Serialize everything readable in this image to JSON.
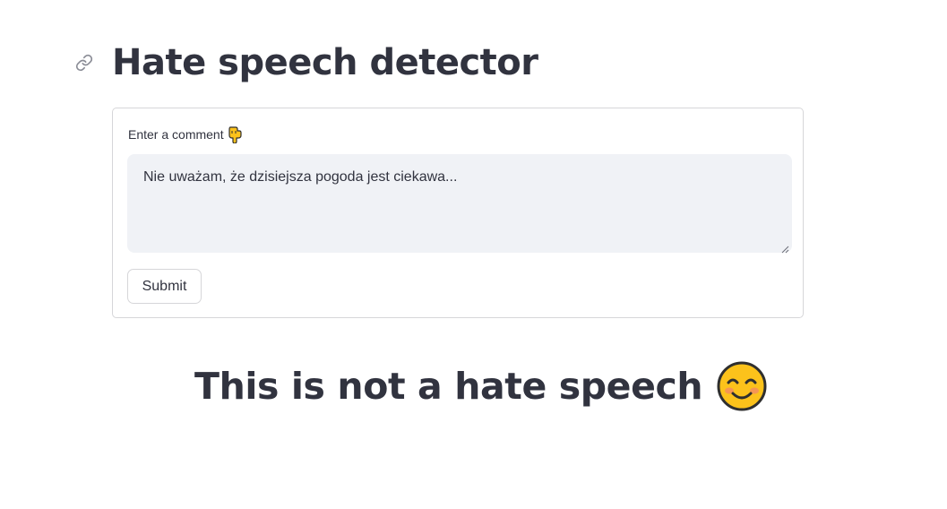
{
  "header": {
    "title": "Hate speech detector",
    "link_icon": "link-icon"
  },
  "form": {
    "label": "Enter a comment",
    "label_icon": "pointing-down-hand-icon",
    "comment_value": "Nie uważam, że dzisiejsza pogoda jest ciekawa...",
    "submit_label": "Submit"
  },
  "result": {
    "text": "This is not a hate speech",
    "icon": "smiling-face-icon"
  },
  "colors": {
    "text": "#31333f",
    "input_bg": "#f0f2f6",
    "border": "#d6d6d9",
    "emoji_yellow": "#fcc21b"
  }
}
